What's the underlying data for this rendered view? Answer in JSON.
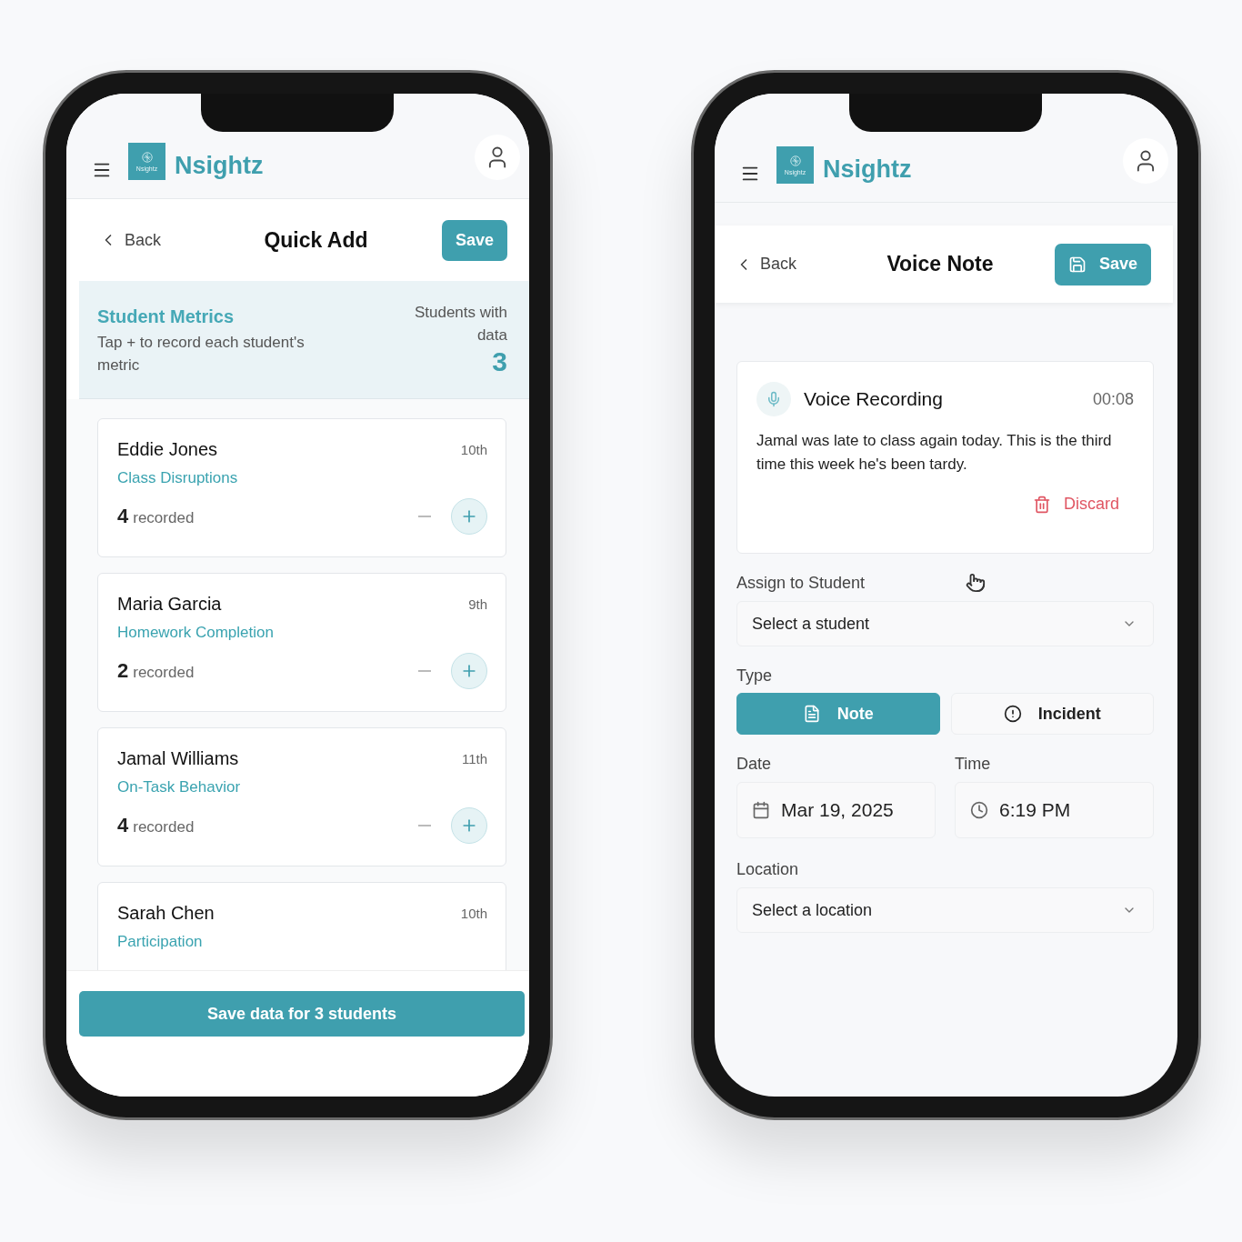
{
  "quick_add_screen": {
    "app_bar": {
      "brand": "Nsightz",
      "logo_caption": "Nsightz"
    },
    "nav": {
      "back": "Back",
      "title": "Quick Add",
      "save": "Save"
    },
    "metrics_banner": {
      "title": "Student Metrics",
      "subtitle": "Tap + to record each student's metric",
      "count_label": "Students with data",
      "count": "3"
    },
    "students": [
      {
        "name": "Eddie Jones",
        "grade": "10th",
        "metric": "Class Disruptions",
        "count": "4",
        "count_label": "recorded"
      },
      {
        "name": "Maria Garcia",
        "grade": "9th",
        "metric": "Homework Completion",
        "count": "2",
        "count_label": "recorded"
      },
      {
        "name": "Jamal Williams",
        "grade": "11th",
        "metric": "On-Task Behavior",
        "count": "4",
        "count_label": "recorded"
      },
      {
        "name": "Sarah Chen",
        "grade": "10th",
        "metric": "Participation"
      }
    ],
    "footer_button": "Save data for 3 students"
  },
  "voice_note_screen": {
    "app_bar": {
      "brand": "Nsightz",
      "logo_caption": "Nsightz"
    },
    "nav": {
      "back": "Back",
      "title": "Voice Note",
      "save": "Save"
    },
    "recording": {
      "title": "Voice Recording",
      "duration": "00:08",
      "transcript": "Jamal was late to class again today. This is the third time this week he's been tardy.",
      "discard": "Discard"
    },
    "assign_student": {
      "label": "Assign to Student",
      "placeholder": "Select a student"
    },
    "type": {
      "label": "Type",
      "options": [
        {
          "kind": "note",
          "label": "Note",
          "selected": true
        },
        {
          "kind": "incident",
          "label": "Incident",
          "selected": false
        }
      ]
    },
    "date": {
      "label": "Date",
      "value": "Mar 19, 2025"
    },
    "time": {
      "label": "Time",
      "value": "6:19 PM"
    },
    "location": {
      "label": "Location",
      "placeholder": "Select a location"
    }
  }
}
